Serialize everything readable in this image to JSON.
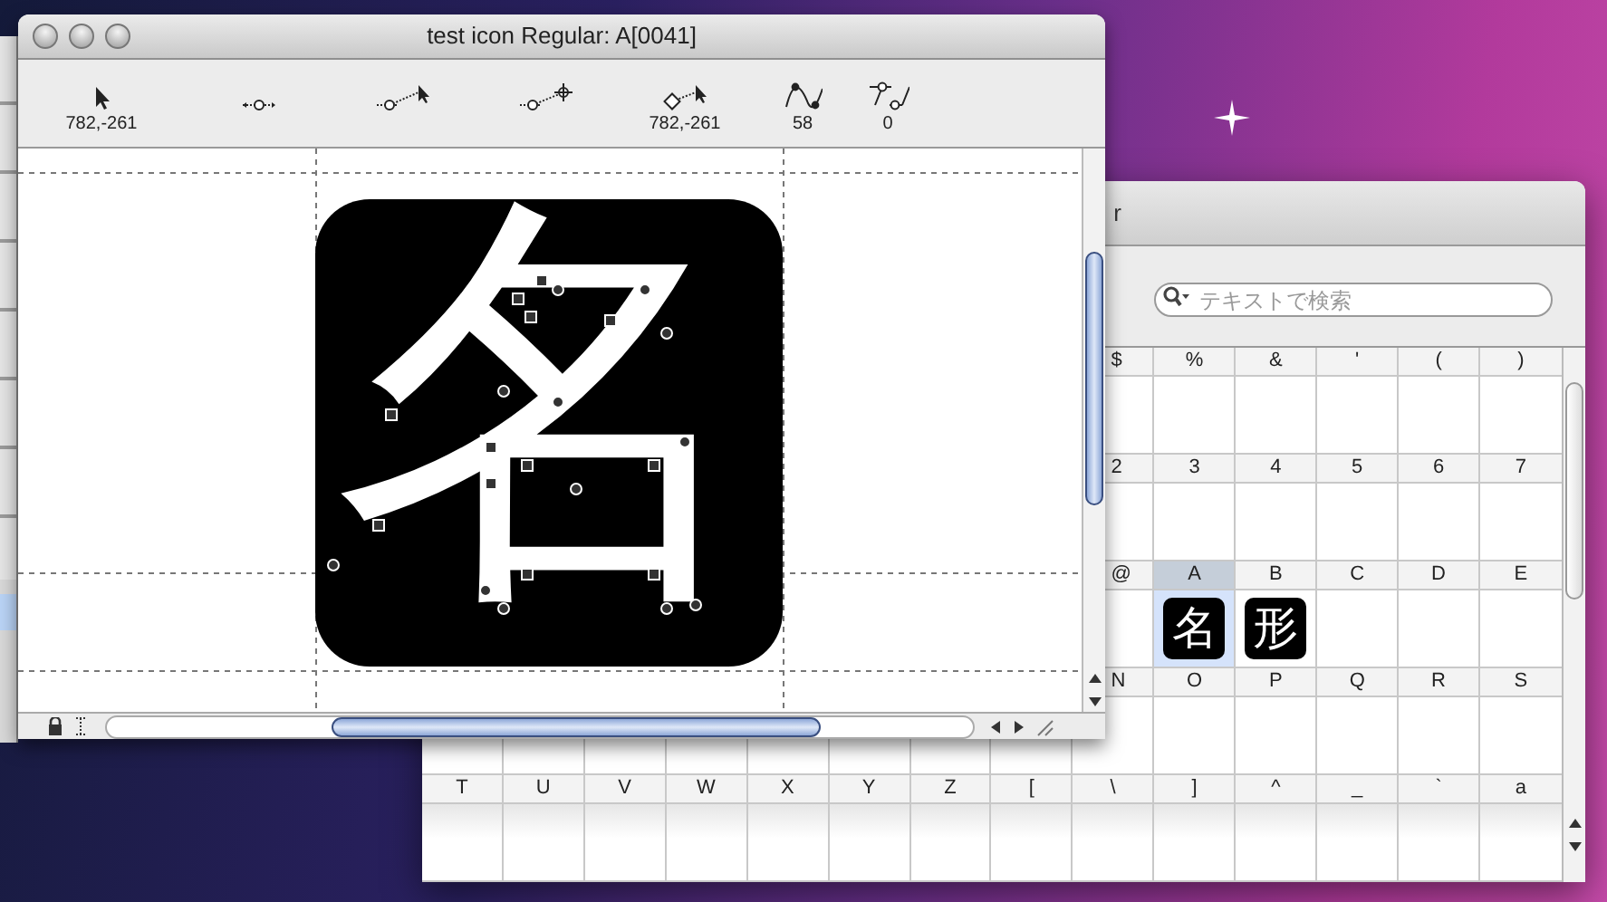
{
  "glyph_window": {
    "title": "test icon Regular: A[0041]",
    "readouts": [
      {
        "kind": "pointer",
        "value": "782,-261"
      },
      {
        "kind": "point"
      },
      {
        "kind": "point-pointer"
      },
      {
        "kind": "point-point"
      },
      {
        "kind": "corner-pointer",
        "value": "782,-261"
      },
      {
        "kind": "curve",
        "value": "58"
      },
      {
        "kind": "offcurve",
        "value": "0"
      }
    ],
    "glyph": "名"
  },
  "font_window": {
    "title": "r",
    "search": {
      "placeholder": "テキストで検索"
    },
    "rows": [
      {
        "cells": [
          {
            "label": "$",
            "selected": false
          },
          {
            "label": "%",
            "selected": false
          },
          {
            "label": "&",
            "selected": false
          },
          {
            "label": "'",
            "selected": false
          },
          {
            "label": "(",
            "selected": false
          },
          {
            "label": ")",
            "selected": false
          }
        ]
      },
      {
        "cells": [
          {
            "label": "2",
            "selected": false
          },
          {
            "label": "3",
            "selected": false
          },
          {
            "label": "4",
            "selected": false
          },
          {
            "label": "5",
            "selected": false
          },
          {
            "label": "6",
            "selected": false
          },
          {
            "label": "7",
            "selected": false
          }
        ]
      },
      {
        "cells": [
          {
            "label": "@",
            "selected": false
          },
          {
            "label": "A",
            "selected": true,
            "glyph": "名"
          },
          {
            "label": "B",
            "selected": false,
            "glyph": "形"
          },
          {
            "label": "C",
            "selected": false
          },
          {
            "label": "D",
            "selected": false
          },
          {
            "label": "E",
            "selected": false
          }
        ]
      },
      {
        "cells": [
          {
            "label": "N",
            "selected": false
          },
          {
            "label": "O",
            "selected": false
          },
          {
            "label": "P",
            "selected": false
          },
          {
            "label": "Q",
            "selected": false
          },
          {
            "label": "R",
            "selected": false
          },
          {
            "label": "S",
            "selected": false
          }
        ]
      },
      {
        "cells": [
          {
            "label": "T",
            "selected": false
          },
          {
            "label": "U",
            "selected": false
          },
          {
            "label": "V",
            "selected": false
          },
          {
            "label": "W",
            "selected": false
          },
          {
            "label": "X",
            "selected": false
          },
          {
            "label": "Y",
            "selected": false
          },
          {
            "label": "Z",
            "selected": false
          },
          {
            "label": "[",
            "selected": false
          },
          {
            "label": "\\",
            "selected": false
          },
          {
            "label": "]",
            "selected": false
          },
          {
            "label": "^",
            "selected": false
          },
          {
            "label": "_",
            "selected": false
          },
          {
            "label": "`",
            "selected": false
          },
          {
            "label": "a",
            "selected": false
          }
        ]
      }
    ]
  }
}
